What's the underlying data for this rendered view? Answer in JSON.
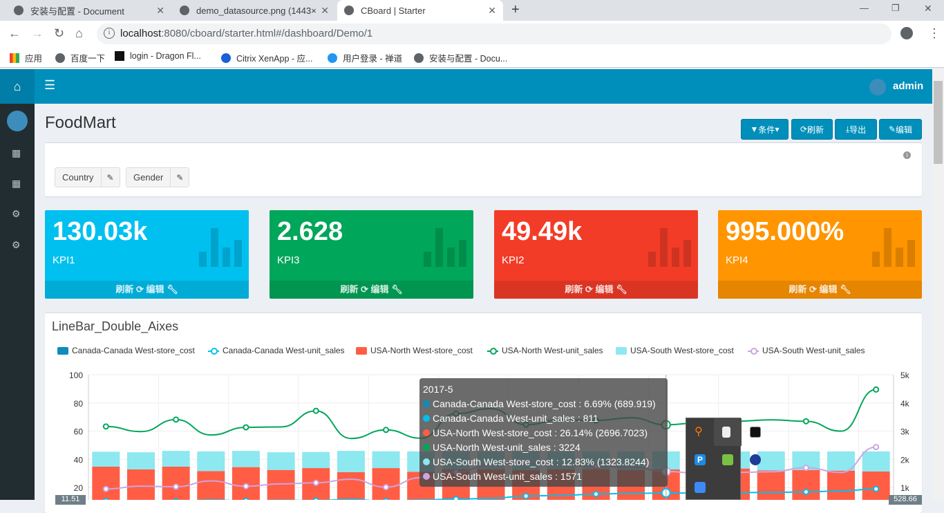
{
  "browser": {
    "tabs": [
      {
        "title": "安装与配置 - Document"
      },
      {
        "title": "demo_datasource.png (1443×"
      },
      {
        "title": "CBoard | Starter"
      }
    ],
    "url_host": "localhost",
    "url_rest": ":8080/cboard/starter.html#/dashboard/Demo/1",
    "bookmarks": [
      "应用",
      "百度一下",
      "login - Dragon Fl...",
      "Citrix XenApp - 应...",
      "用户登录 - 禅道",
      "安装与配置 - Docu..."
    ]
  },
  "header": {
    "user": "admin"
  },
  "page": {
    "title": "FoodMart",
    "buttons": {
      "filter": "条件",
      "refresh": "刷新",
      "export": "导出",
      "edit": "编辑"
    },
    "filters": [
      {
        "label": "Country"
      },
      {
        "label": "Gender"
      }
    ]
  },
  "kpis": [
    {
      "value": "130.03k",
      "label": "KPI1",
      "color": "#00c0ef"
    },
    {
      "value": "2.628",
      "label": "KPI3",
      "color": "#00a65a"
    },
    {
      "value": "49.49k",
      "label": "KPI2",
      "color": "#f33c27"
    },
    {
      "value": "995.000%",
      "label": "KPI4",
      "color": "#ff9500"
    }
  ],
  "kpi_footer": {
    "refresh": "刷新",
    "edit": "编辑"
  },
  "chart_data": {
    "type": "bar+line",
    "title": "LineBar_Double_Aixes",
    "left_axis": {
      "ticks": [
        "20",
        "40",
        "60",
        "80",
        "100"
      ],
      "range": [
        0,
        100
      ]
    },
    "right_axis": {
      "ticks": [
        "1k",
        "2k",
        "3k",
        "4k",
        "5k"
      ],
      "range": [
        0,
        5000
      ]
    },
    "grid": true,
    "legend_position": "top",
    "series": [
      {
        "name": "Canada-Canada West-store_cost",
        "type": "bar",
        "stack": "cost",
        "axis": "left",
        "color": "#0e8cba",
        "values": [
          6.7,
          6.7,
          6.7,
          6.7,
          6.7,
          6.7,
          6.7,
          6.7,
          6.7,
          6.7,
          6.7,
          6.7,
          6.7,
          6.7,
          6.7,
          6.7,
          6.69,
          6.7,
          6.7,
          6.7,
          6.7,
          6.7,
          6.7
        ]
      },
      {
        "name": "Canada-Canada West-unit_sales",
        "type": "line",
        "axis": "right",
        "color": "#00c0ef",
        "values": [
          520,
          540,
          510,
          560,
          530,
          550,
          540,
          580,
          520,
          560,
          590,
          620,
          700,
          720,
          770,
          790,
          811,
          800,
          820,
          830,
          845,
          880,
          950
        ]
      },
      {
        "name": "USA-North West-store_cost",
        "type": "bar",
        "stack": "cost",
        "axis": "left",
        "color": "#ff5e45",
        "values": [
          28.1,
          26.2,
          28.1,
          25.0,
          27.8,
          25.8,
          27.1,
          24.2,
          27.1,
          24.5,
          26.3,
          26.3,
          25.8,
          26.3,
          26.3,
          25.8,
          26.14,
          26.3,
          26.8,
          25.5,
          25.8,
          25.3,
          24.7
        ]
      },
      {
        "name": "USA-North West-unit_sales",
        "type": "line",
        "axis": "right",
        "color": "#00a65a",
        "values": [
          3165,
          2985,
          3410,
          2865,
          3135,
          3150,
          3720,
          2740,
          3045,
          2750,
          3620,
          3800,
          3230,
          3400,
          3380,
          3475,
          3224,
          3300,
          3350,
          3400,
          3350,
          3000,
          4475
        ]
      },
      {
        "name": "USA-South West-store_cost",
        "type": "bar",
        "stack": "cost",
        "axis": "left",
        "color": "#8de8f0",
        "values": [
          10.6,
          12.1,
          11.2,
          13.9,
          11.5,
          12.5,
          11.4,
          15.1,
          11.9,
          14.4,
          12.7,
          12.5,
          13.1,
          12.5,
          12.6,
          13.0,
          12.83,
          12.6,
          12.1,
          13.4,
          13.1,
          13.6,
          14.2
        ]
      },
      {
        "name": "USA-South West-unit_sales",
        "type": "line",
        "axis": "right",
        "color": "#c9a6e0",
        "values": [
          950,
          1050,
          1030,
          1235,
          1045,
          1130,
          1170,
          1295,
          1015,
          1350,
          1550,
          1800,
          1885,
          1800,
          1750,
          1725,
          1571,
          1500,
          1535,
          1560,
          1700,
          1535,
          2435
        ]
      }
    ],
    "tooltip": {
      "title": "2017-5",
      "index": 16,
      "rows": [
        {
          "text": "Canada-Canada West-store_cost : 6.69% (689.919)",
          "color": "#0e8cba"
        },
        {
          "text": "Canada-Canada West-unit_sales : 811",
          "color": "#00c0ef"
        },
        {
          "text": "USA-North West-store_cost : 26.14% (2696.7023)",
          "color": "#ff5e45"
        },
        {
          "text": "USA-North West-unit_sales : 3224",
          "color": "#00a65a"
        },
        {
          "text": "USA-South West-store_cost : 12.83% (1323.8244)",
          "color": "#8de8f0"
        },
        {
          "text": "USA-South West-unit_sales : 1571",
          "color": "#c9a6e0"
        }
      ]
    },
    "pointer_labels": {
      "left": "11.51",
      "right": "528.66"
    }
  }
}
